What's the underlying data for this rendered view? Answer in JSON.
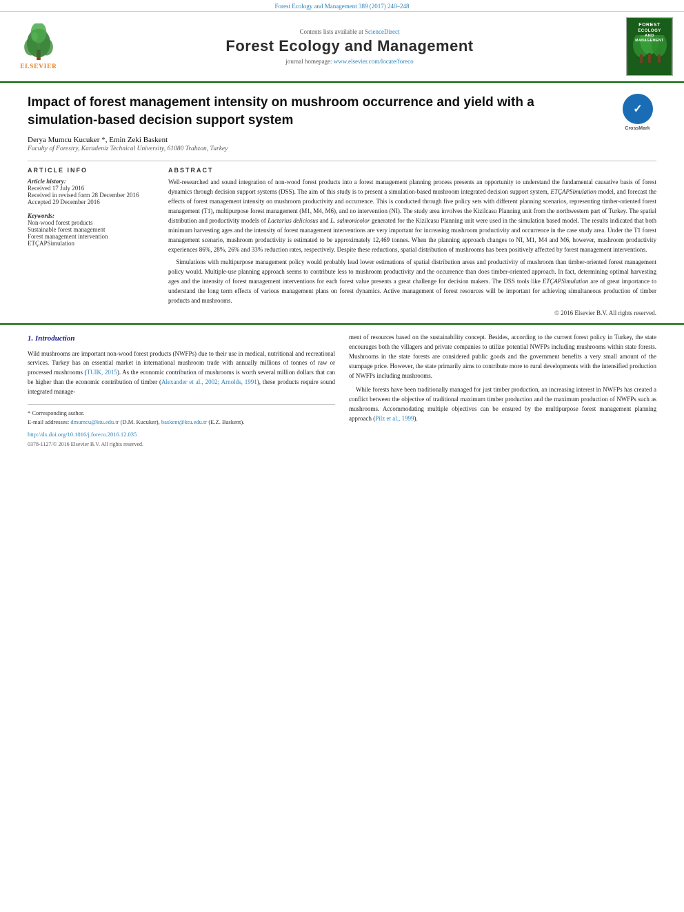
{
  "top_bar": {
    "text": "Forest Ecology and Management 389 (2017) 240–248"
  },
  "header": {
    "sciencedirect_label": "Contents lists available at",
    "sciencedirect_link": "ScienceDirect",
    "journal_title": "Forest Ecology and Management",
    "homepage_label": "journal homepage:",
    "homepage_url": "www.elsevier.com/locate/foreco",
    "elsevier_label": "ELSEVIER",
    "cover_lines": [
      "FOREST",
      "ECOLOGY",
      "AND",
      "MANAGEMENT"
    ]
  },
  "article": {
    "title": "Impact of forest management intensity on mushroom occurrence and yield with a simulation-based decision support system",
    "crossmark_symbol": "✓",
    "crossmark_label": "CrossMark",
    "authors": "Derya Mumcu Kucuker *, Emin Zeki Baskent",
    "affiliation": "Faculty of Forestry, Karadeniz Technical University, 61080 Trabzon, Turkey"
  },
  "article_info": {
    "heading": "ARTICLE   INFO",
    "history_label": "Article history:",
    "received": "Received 17 July 2016",
    "revised": "Received in revised form 28 December 2016",
    "accepted": "Accepted 29 December 2016",
    "keywords_label": "Keywords:",
    "keywords": [
      "Non-wood forest products",
      "Sustainable forest management",
      "Forest management intervention",
      "ETÇAPSimulation"
    ]
  },
  "abstract": {
    "heading": "ABSTRACT",
    "paragraph1": "Well-researched and sound integration of non-wood forest products into a forest management planning process presents an opportunity to understand the fundamental causative basis of forest dynamics through decision support systems (DSS). The aim of this study is to present a simulation-based mushroom integrated decision support system, ETÇAPSimulation model, and forecast the effects of forest management intensity on mushroom productivity and occurrence. This is conducted through five policy sets with different planning scenarios, representing timber-oriented forest management (T1), multipurpose forest management (M1, M4, M6), and no intervention (NI). The study area involves the Kizilcasu Planning unit from the northwestern part of Turkey. The spatial distribution and productivity models of Lactarius deliciosus and L. salmonicolor generated for the Kizilcasu Planning unit were used in the simulation based model. The results indicated that both minimum harvesting ages and the intensity of forest management interventions are very important for increasing mushroom productivity and occurrence in the case study area. Under the T1 forest management scenario, mushroom productivity is estimated to be approximately 12,469 tonnes. When the planning approach changes to NI, M1, M4 and M6, however, mushroom productivity experiences 86%, 28%, 26% and 33% reduction rates, respectively. Despite these reductions, spatial distribution of mushrooms has been positively affected by forest management interventions.",
    "paragraph2": "Simulations with multipurpose management policy would probably lead lower estimations of spatial distribution areas and productivity of mushroom than timber-oriented forest management policy would. Multiple-use planning approach seems to contribute less to mushroom productivity and the occurrence than does timber-oriented approach. In fact, determining optimal harvesting ages and the intensity of forest management interventions for each forest value presents a great challenge for decision makers. The DSS tools like ETÇAPSimulation are of great importance to understand the long term effects of various management plans on forest dynamics. Active management of forest resources will be important for achieving simultaneous production of timber products and mushrooms.",
    "copyright": "© 2016 Elsevier B.V. All rights reserved."
  },
  "intro": {
    "section_title": "1. Introduction",
    "col1_paragraphs": [
      "Wild mushrooms are important non-wood forest products (NWFPs) due to their use in medical, nutritional and recreational services. Turkey has an essential market in international mushroom trade with annually millions of tonnes of raw or processed mushrooms (TUIK, 2015). As the economic contribution of mushrooms is worth several million dollars that can be higher than the economic contribution of timber (Alexander et al., 2002; Arnolds, 1991), these products require sound integrated manage-",
      ""
    ],
    "col2_paragraphs": [
      "ment of resources based on the sustainability concept. Besides, according to the current forest policy in Turkey, the state encourages both the villagers and private companies to utilize potential NWFPs including mushrooms within state forests. Mushrooms in the state forests are considered public goods and the government benefits a very small amount of the stumpage price. However, the state primarily aims to contribute more to rural developments with the intensified production of NWFPs including mushrooms.",
      "While forests have been traditionally managed for just timber production, an increasing interest in NWFPs has created a conflict between the objective of traditional maximum timber production and the maximum production of NWFPs such as mushrooms. Accommodating multiple objectives can be ensured by the multipurpose forest management planning approach (Pilz et al., 1999)."
    ]
  },
  "footnotes": {
    "corresponding_author": "* Corresponding author.",
    "email_label": "E-mail addresses:",
    "email1": "dmumcu@ktu.edu.tr",
    "email1_name": "(D.M. Kucuker),",
    "email2": "baskent@ktu.edu.tr",
    "email2_name": "(E.Z. Baskent).",
    "doi": "http://dx.doi.org/10.1016/j.foreco.2016.12.035",
    "issn": "0378-1127/© 2016 Elsevier B.V. All rights reserved."
  }
}
